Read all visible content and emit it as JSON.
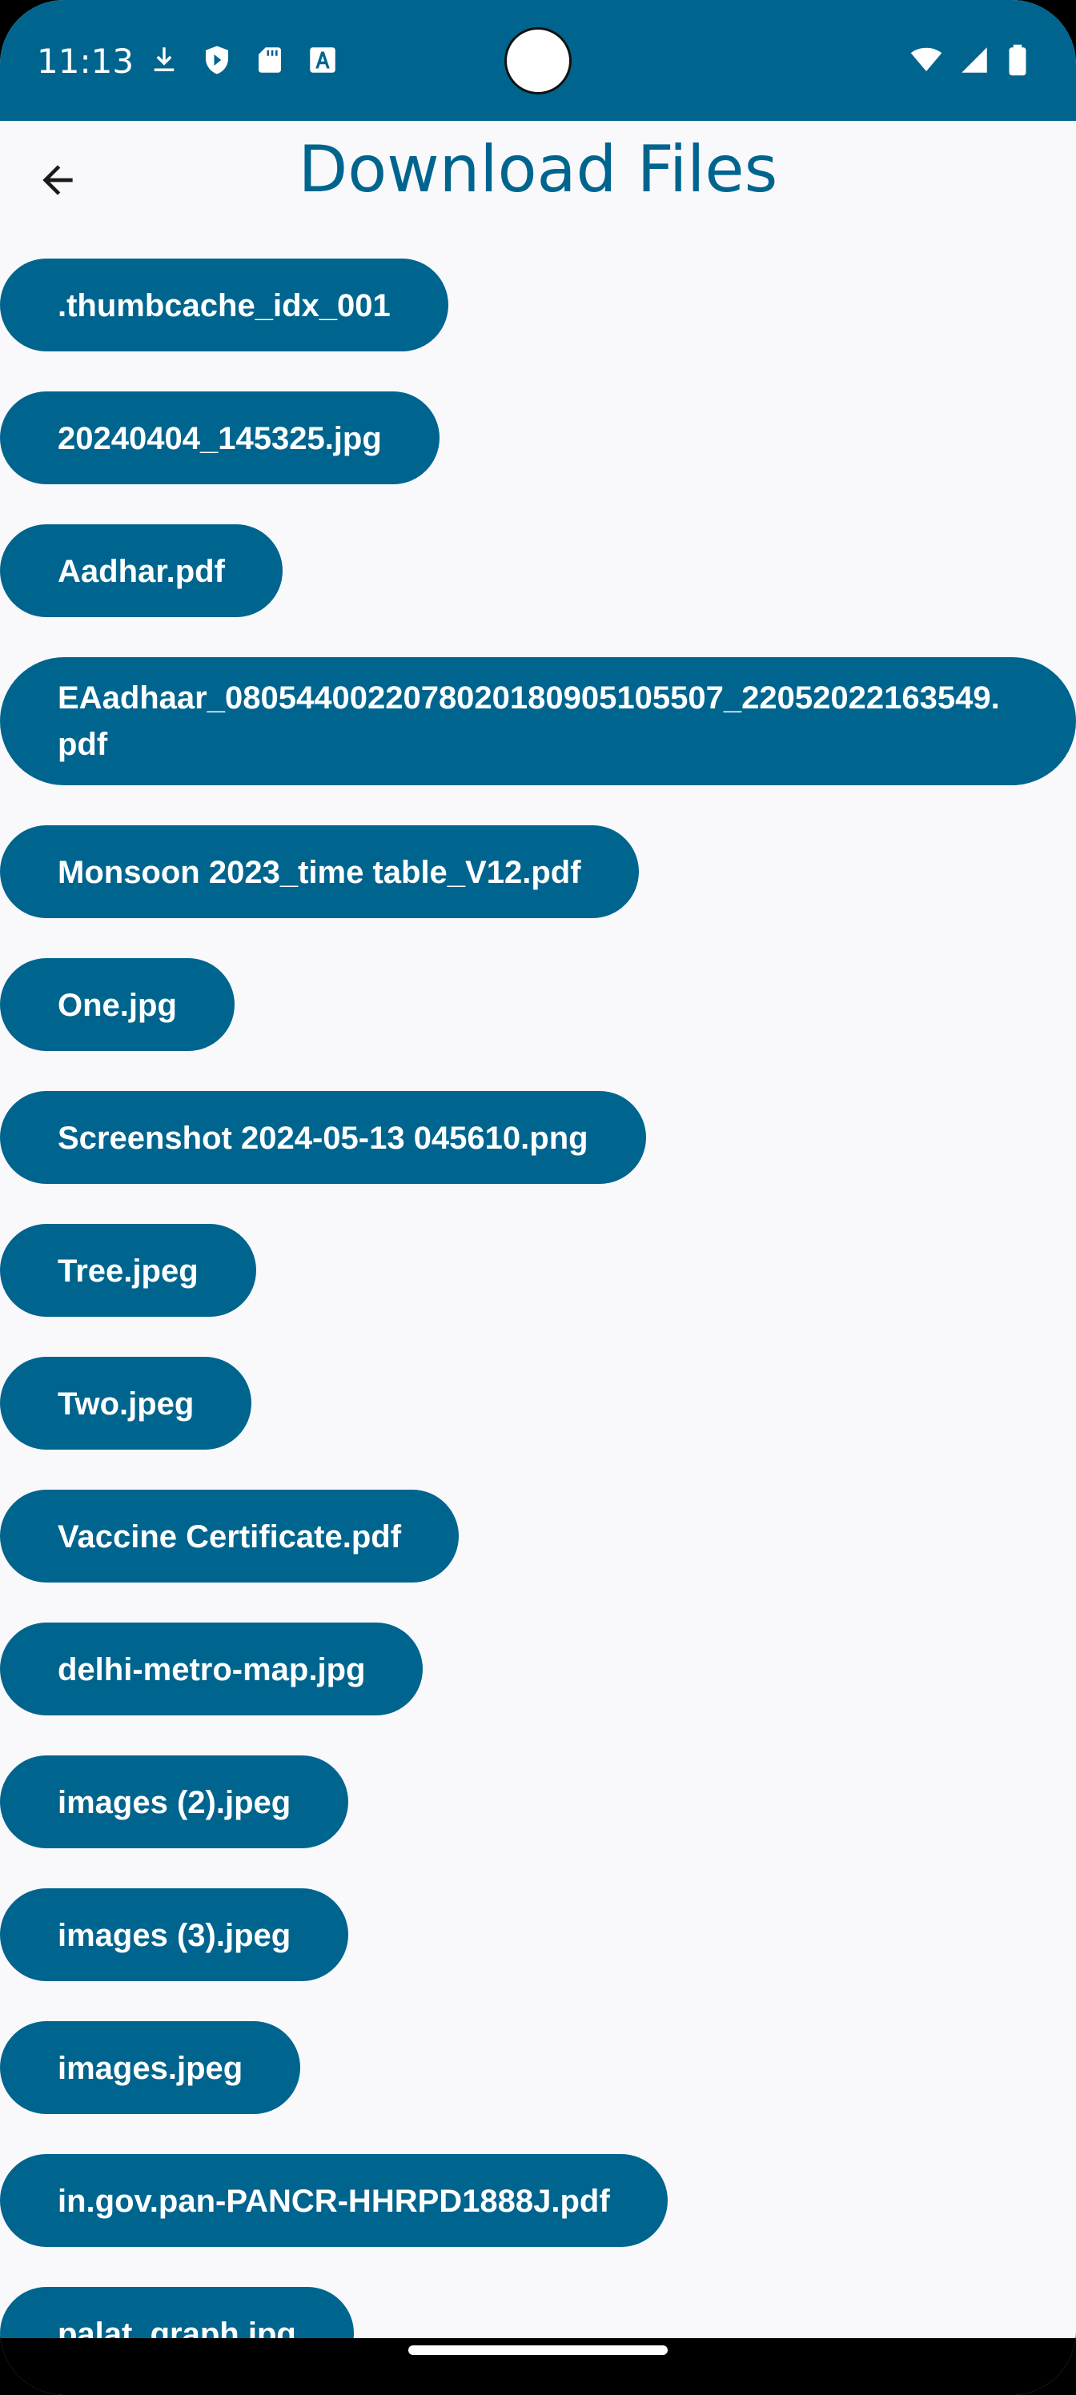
{
  "status_bar": {
    "time": "11:13",
    "left_icons": [
      "download-icon",
      "shield-icon",
      "sd-card-icon",
      "font-a-icon"
    ],
    "right_icons": [
      "wifi-icon",
      "cell-signal-icon",
      "battery-icon"
    ],
    "background": "#00658e"
  },
  "app_bar": {
    "title": "Download Files",
    "back_icon": "arrow-back-icon",
    "title_color": "#00658e"
  },
  "files": [
    ".thumbcache_idx_001",
    "20240404_145325.jpg",
    "Aadhar.pdf",
    "EAadhaar_0805440022078020180905105507_22052022163549.pdf",
    "Monsoon 2023_time table_V12.pdf",
    "One.jpg",
    "Screenshot 2024-05-13 045610.png",
    "Tree.jpeg",
    "Two.jpeg",
    "Vaccine Certificate.pdf",
    "delhi-metro-map.jpg",
    "images (2).jpeg",
    "images (3).jpeg",
    "images.jpeg",
    "in.gov.pan-PANCR-HHRPD1888J.pdf",
    "palat_graph.jpg"
  ],
  "colors": {
    "chip_background": "#00658e",
    "chip_text": "#ffffff",
    "page_background": "#f9f9fc"
  }
}
